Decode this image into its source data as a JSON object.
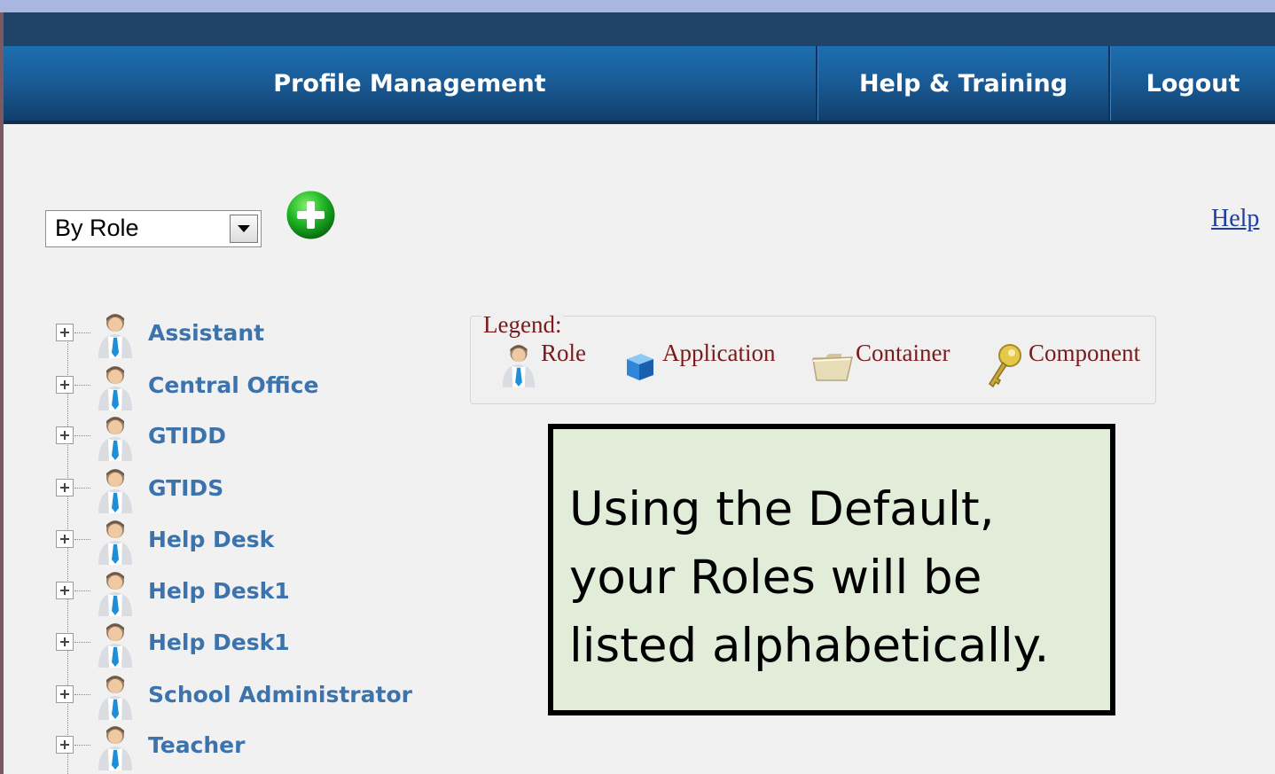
{
  "nav": {
    "items": [
      {
        "label": "Profile Management"
      },
      {
        "label": "Help & Training"
      },
      {
        "label": "Logout"
      }
    ]
  },
  "toolbar": {
    "view_select_value": "By Role",
    "add_icon": "add-icon",
    "help_label": "Help"
  },
  "tree": {
    "items": [
      {
        "label": "Assistant"
      },
      {
        "label": "Central Office"
      },
      {
        "label": "GTIDD"
      },
      {
        "label": "GTIDS"
      },
      {
        "label": "Help Desk"
      },
      {
        "label": "Help Desk1"
      },
      {
        "label": "Help Desk1"
      },
      {
        "label": "School Administrator"
      },
      {
        "label": "Teacher"
      }
    ]
  },
  "legend": {
    "title": "Legend:",
    "entries": [
      {
        "label": "Role",
        "icon": "role-icon"
      },
      {
        "label": "Application",
        "icon": "application-icon"
      },
      {
        "label": "Container",
        "icon": "container-icon"
      },
      {
        "label": "Component",
        "icon": "component-icon"
      }
    ]
  },
  "callout": {
    "text": "Using the Default, your Roles will be listed alphabetically."
  },
  "colors": {
    "nav_blue": "#1a5c98",
    "link_blue": "#3d73ad",
    "legend_text": "#7a1a1a",
    "callout_bg": "#e2edd9"
  }
}
